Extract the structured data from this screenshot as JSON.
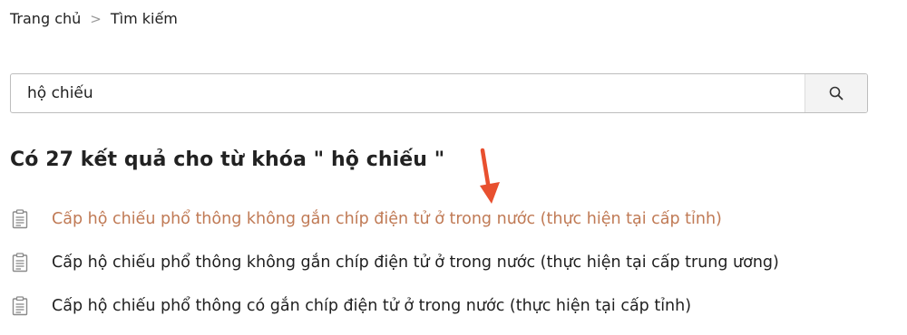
{
  "breadcrumb": {
    "home": "Trang chủ",
    "separator": ">",
    "current": "Tìm kiếm"
  },
  "search": {
    "value": "hộ chiếu",
    "button_icon": "search-icon"
  },
  "results_heading": "Có 27 kết quả cho từ khóa \" hộ chiếu \"",
  "results": [
    {
      "label": "Cấp hộ chiếu phổ thông không gắn chíp điện tử ở trong nước (thực hiện tại cấp tỉnh)",
      "icon": "document-icon",
      "highlighted": true
    },
    {
      "label": "Cấp hộ chiếu phổ thông không gắn chíp điện tử ở trong nước (thực hiện tại cấp trung ương)",
      "icon": "document-icon",
      "highlighted": false
    },
    {
      "label": "Cấp hộ chiếu phổ thông có gắn chíp điện tử ở trong nước (thực hiện tại cấp tỉnh)",
      "icon": "document-icon",
      "highlighted": false
    }
  ],
  "colors": {
    "highlight_text": "#c07a55",
    "annotation_arrow": "#e8502f",
    "icon": "#8a8a8a"
  }
}
